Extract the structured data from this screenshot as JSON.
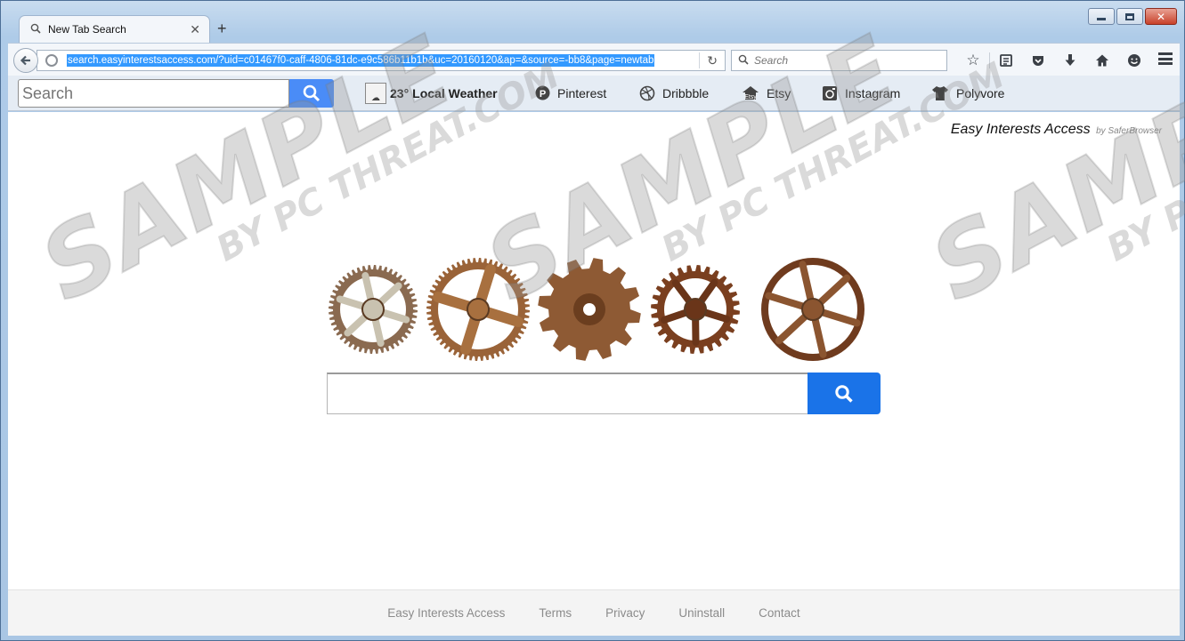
{
  "browser": {
    "tab_title": "New Tab Search",
    "url": "search.easyinterestsaccess.com/?uid=c01467f0-caff-4806-81dc-e9c586b11b1b&uc=20160120&ap=&source=-bb8&page=newtab",
    "search_placeholder": "Search"
  },
  "toolbar": {
    "search_placeholder": "Search",
    "weather_temp": "23°",
    "weather_label": "Local Weather",
    "links": [
      {
        "label": "Pinterest",
        "icon": "pinterest-icon"
      },
      {
        "label": "Dribbble",
        "icon": "dribbble-icon"
      },
      {
        "label": "Etsy",
        "icon": "etsy-icon"
      },
      {
        "label": "Instagram",
        "icon": "instagram-icon"
      },
      {
        "label": "Polyvore",
        "icon": "polyvore-icon"
      }
    ]
  },
  "page": {
    "brand_name": "Easy Interests Access",
    "brand_by": "by SaferBrowser",
    "search_button_color": "#1a73e8"
  },
  "footer": {
    "links": [
      "Easy Interests Access",
      "Terms",
      "Privacy",
      "Uninstall",
      "Contact"
    ]
  },
  "watermark": {
    "big": "SAMPLE",
    "small": "BY PC THREAT.COM"
  }
}
